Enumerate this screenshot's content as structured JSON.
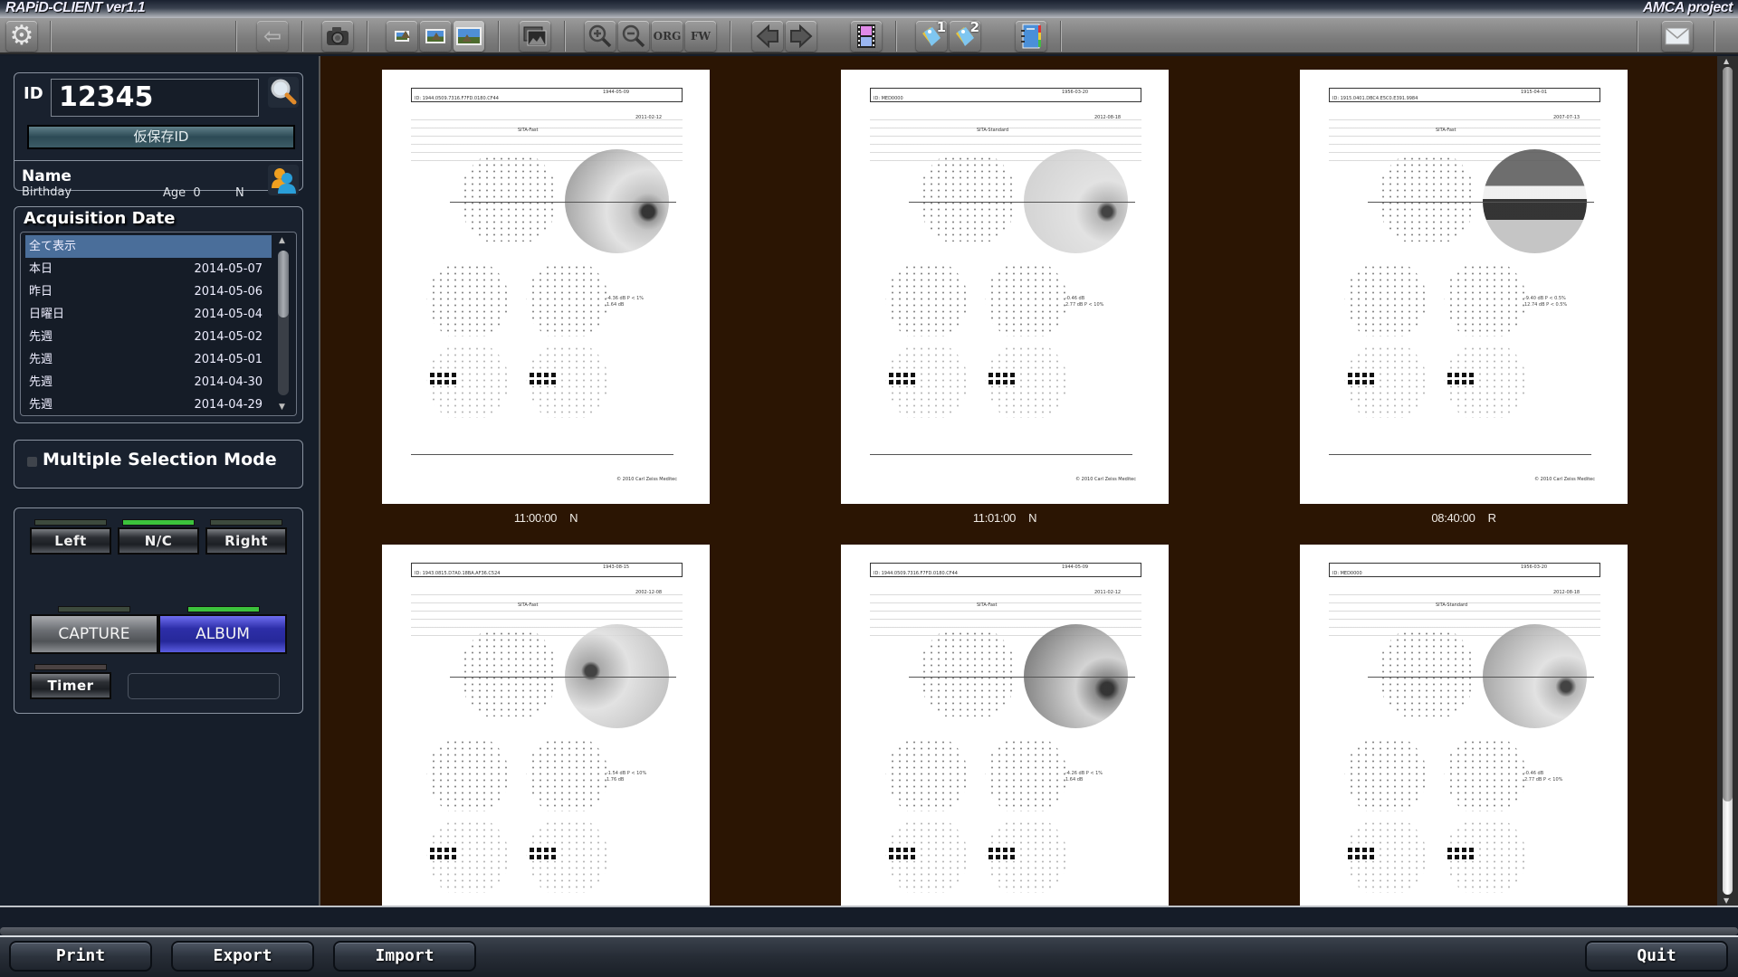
{
  "window": {
    "app_title": "RAPiD-CLIENT ver1.1",
    "project_label": "AMCA project"
  },
  "toolbar": {
    "items": [
      {
        "name": "settings",
        "icon": "gear-icon"
      },
      {
        "name": "back",
        "icon": "arrow-left-icon"
      },
      {
        "name": "camera",
        "icon": "camera-icon"
      },
      {
        "name": "image-small",
        "icon": "image-small-icon"
      },
      {
        "name": "image-medium",
        "icon": "image-medium-icon"
      },
      {
        "name": "image-large",
        "icon": "image-large-icon"
      },
      {
        "name": "gallery",
        "icon": "gallery-icon"
      },
      {
        "name": "zoom-in",
        "icon": "zoom-in-icon"
      },
      {
        "name": "zoom-out",
        "icon": "zoom-out-icon"
      },
      {
        "name": "original-size",
        "label": "ORG"
      },
      {
        "name": "fit-window",
        "label": "FW"
      },
      {
        "name": "previous",
        "icon": "arrow-prev-icon"
      },
      {
        "name": "next",
        "icon": "arrow-next-icon"
      },
      {
        "name": "movie",
        "icon": "film-icon"
      },
      {
        "name": "tag-1",
        "icon": "tag-icon",
        "badge": "1"
      },
      {
        "name": "tag-2",
        "icon": "tag-icon",
        "badge": "2"
      },
      {
        "name": "notebook",
        "icon": "notebook-icon"
      },
      {
        "name": "mail",
        "icon": "mail-icon"
      }
    ]
  },
  "patient": {
    "id_label": "ID",
    "id_value": "12345",
    "temp_id_label": "仮保存ID",
    "name_label": "Name",
    "birthday_label": "Birthday",
    "age_label": "Age",
    "age_value": "0",
    "sex_value": "N"
  },
  "acquisition": {
    "title": "Acquisition Date",
    "items": [
      {
        "label": "全て表示",
        "date": "",
        "selected": true
      },
      {
        "label": "本日",
        "date": "2014-05-07"
      },
      {
        "label": "昨日",
        "date": "2014-05-06"
      },
      {
        "label": "日曜日",
        "date": "2014-05-04"
      },
      {
        "label": "先週",
        "date": "2014-05-02"
      },
      {
        "label": "先週",
        "date": "2014-05-01"
      },
      {
        "label": "先週",
        "date": "2014-04-30"
      },
      {
        "label": "先週",
        "date": "2014-04-29"
      }
    ]
  },
  "multi_select": {
    "label": "Multiple Selection Mode",
    "checked": false
  },
  "controls": {
    "eye_buttons": [
      {
        "label": "Left",
        "active": false
      },
      {
        "label": "N/C",
        "active": true
      },
      {
        "label": "Right",
        "active": false
      }
    ],
    "mode_buttons": [
      {
        "label": "CAPTURE",
        "active": false
      },
      {
        "label": "ALBUM",
        "active": true
      }
    ],
    "timer_label": "Timer",
    "timer_value": ""
  },
  "thumbnails": [
    {
      "time": "11:00:00",
      "eye": "N",
      "report_id": "ID: 1944.0509.7316.F7FD.0180.CF44",
      "dob": "1944-05-09",
      "exam_date": "2011-02-12",
      "strategy": "SITA-Fast",
      "vfi": "",
      "md": "-4.36 dB P < 1%",
      "psd": "1.64 dB"
    },
    {
      "time": "11:01:00",
      "eye": "N",
      "report_id": "ID: MED0000",
      "dob": "1956-03-20",
      "exam_date": "2012-08-18",
      "strategy": "SITA-Standard",
      "vfi": "",
      "md": "-0.46 dB",
      "psd": "2.77 dB P < 10%"
    },
    {
      "time": "08:40:00",
      "eye": "R",
      "report_id": "ID: 1915.0401.DBC4.E5C0.E391.9984",
      "dob": "1915-04-01",
      "exam_date": "2007-07-13",
      "strategy": "SITA-Fast",
      "vfi": "",
      "md": "-9.40 dB P < 0.5%",
      "psd": "12.74 dB P < 0.5%"
    },
    {
      "time": "",
      "eye": "",
      "report_id": "ID: 1943.0815.D7A0.18BA.AF36.C524",
      "dob": "1943-08-15",
      "exam_date": "2002-12-08",
      "strategy": "SITA-Fast",
      "vfi": "",
      "md": "-1.54 dB P < 10%",
      "psd": "1.76 dB"
    },
    {
      "time": "",
      "eye": "",
      "report_id": "ID: 1944.0509.7316.F7FD.0180.CF44",
      "dob": "1944-05-09",
      "exam_date": "2011-02-12",
      "strategy": "SITA-Fast",
      "vfi": "",
      "md": "-4.26 dB P < 1%",
      "psd": "1.64 dB"
    },
    {
      "time": "",
      "eye": "",
      "report_id": "ID: MED0000",
      "dob": "1956-03-20",
      "exam_date": "2012-08-18",
      "strategy": "SITA-Standard",
      "vfi": "",
      "md": "-0.46 dB",
      "psd": "2.77 dB P < 10%"
    }
  ],
  "report_footer": "© 2010 Carl Zeiss Meditec",
  "bottom": {
    "print_label": "Print",
    "export_label": "Export",
    "import_label": "Import",
    "quit_label": "Quit"
  },
  "colors": {
    "viewer_bg": "#2b1503",
    "selected_row": "#4a6e9a",
    "led_on": "#3cc23c",
    "album_active": "#2d2ea8"
  }
}
